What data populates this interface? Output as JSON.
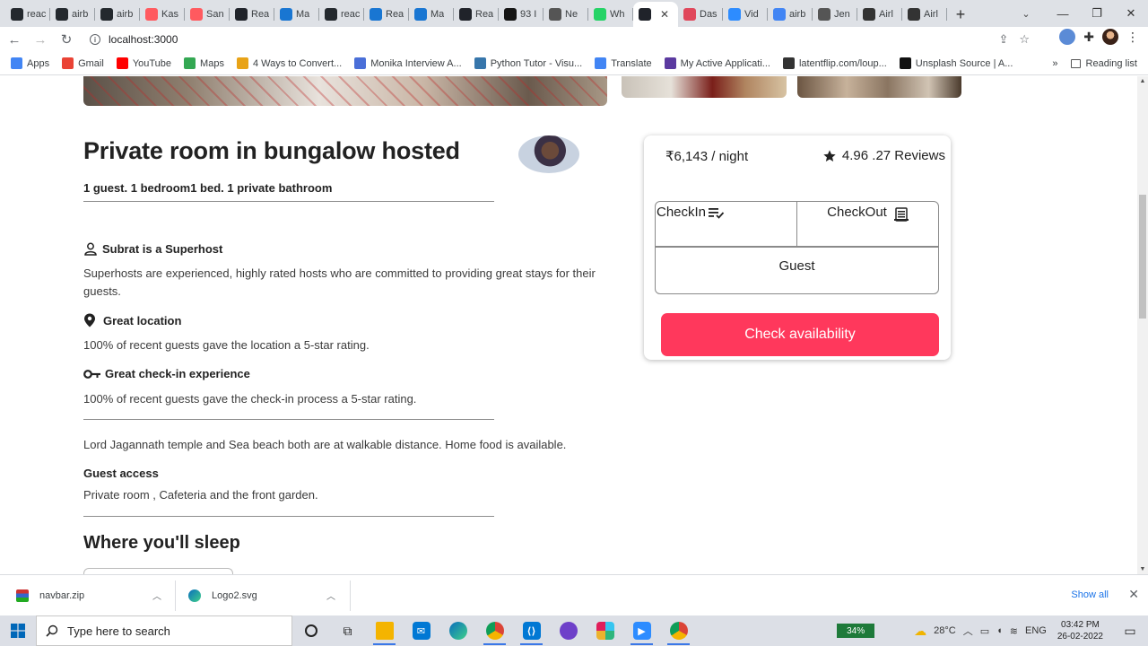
{
  "browser": {
    "tabs": [
      {
        "label": "reac",
        "icon": "github-icon",
        "color": "#24292e"
      },
      {
        "label": "airb",
        "icon": "github-icon",
        "color": "#24292e"
      },
      {
        "label": "airb",
        "icon": "github-icon",
        "color": "#24292e"
      },
      {
        "label": "Kas",
        "icon": "airbnb-icon",
        "color": "#ff5a5f"
      },
      {
        "label": "San",
        "icon": "airbnb-icon",
        "color": "#ff5a5f"
      },
      {
        "label": "Rea",
        "icon": "react-icon",
        "color": "#20232a"
      },
      {
        "label": "Ma",
        "icon": "mui-icon",
        "color": "#1976d2"
      },
      {
        "label": "reac",
        "icon": "github-icon",
        "color": "#24292e"
      },
      {
        "label": "Rea",
        "icon": "mui-icon",
        "color": "#1976d2"
      },
      {
        "label": "Ma",
        "icon": "mui-icon",
        "color": "#1976d2"
      },
      {
        "label": "Rea",
        "icon": "react-icon",
        "color": "#20232a"
      },
      {
        "label": "93 I",
        "icon": "codesandbox-icon",
        "color": "#151515"
      },
      {
        "label": "Ne",
        "icon": "ne-icon",
        "color": "#555555"
      },
      {
        "label": "Wh",
        "icon": "whatsapp-icon",
        "color": "#25d366"
      },
      {
        "label": "",
        "icon": "react-icon",
        "color": "#20232a",
        "active": true
      },
      {
        "label": "Das",
        "icon": "dashboard-icon",
        "color": "#e0475b"
      },
      {
        "label": "Vid",
        "icon": "zoom-icon",
        "color": "#2d8cff"
      },
      {
        "label": "airb",
        "icon": "google-icon",
        "color": "#4285f4"
      },
      {
        "label": "Jen",
        "icon": "globe-icon",
        "color": "#555555"
      },
      {
        "label": "Airl",
        "icon": "codesandbox-icon",
        "color": "#333333"
      },
      {
        "label": "Airl",
        "icon": "codesandbox-icon",
        "color": "#333333"
      }
    ],
    "url": "localhost:3000",
    "bookmarks": [
      {
        "label": "Apps",
        "color": "#4285f4"
      },
      {
        "label": "Gmail",
        "color": "#ea4335"
      },
      {
        "label": "YouTube",
        "color": "#ff0000"
      },
      {
        "label": "Maps",
        "color": "#34a853"
      },
      {
        "label": "4 Ways to Convert...",
        "color": "#e8a317"
      },
      {
        "label": "Monika Interview A...",
        "color": "#4a6fd8"
      },
      {
        "label": "Python Tutor - Visu...",
        "color": "#3776ab"
      },
      {
        "label": "Translate",
        "color": "#4285f4"
      },
      {
        "label": "My Active Applicati...",
        "color": "#5b3aa0"
      },
      {
        "label": "latentflip.com/loup...",
        "color": "#333333"
      },
      {
        "label": "Unsplash Source | A...",
        "color": "#111111"
      }
    ],
    "more_bookmarks": "»",
    "reading_list": "Reading list"
  },
  "listing": {
    "title": "Private room in bungalow hosted",
    "subtitle": "1 guest. 1 bedroom1 bed. 1 private bathroom",
    "features": [
      {
        "heading": "Subrat is a Superhost",
        "icon": "person-icon",
        "text": "Superhosts are experienced, highly rated hosts who are committed to providing great stays for their guests."
      },
      {
        "heading": "Great location",
        "icon": "location-pin-icon",
        "text": "100% of recent guests gave the location a 5-star rating."
      },
      {
        "heading": "Great check-in experience",
        "icon": "key-icon",
        "text": "100% of recent guests gave the check-in process a 5-star rating."
      }
    ],
    "description": "Lord Jagannath temple and Sea beach both are at walkable distance. Home food is available.",
    "guest_access_heading": "Guest access",
    "guest_access_text": "Private room , Cafeteria and the front garden.",
    "sleep_heading": "Where you'll sleep"
  },
  "booking": {
    "price": "₹6,143 / night",
    "rating": "4.96 .27 Reviews",
    "checkin_label": "CheckIn",
    "checkout_label": "CheckOut",
    "guest_label": "Guest",
    "button_label": "Check availability",
    "accent": "#ff385c"
  },
  "downloads": [
    {
      "name": "navbar.zip",
      "icon": "zip-icon"
    },
    {
      "name": "Logo2.svg",
      "icon": "edge-icon"
    }
  ],
  "downloads_show_all": "Show all",
  "taskbar": {
    "search_placeholder": "Type here to search",
    "battery": "34%",
    "weather": "28°C",
    "language": "ENG",
    "time": "03:42 PM",
    "date": "26-02-2022"
  }
}
